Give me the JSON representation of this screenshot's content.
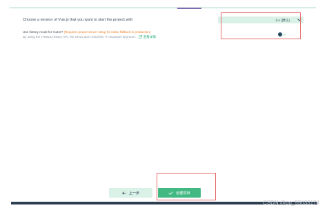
{
  "question": "Choose a version of Vue.js that you want to start the project with",
  "version_select": {
    "value": "3.x (默认)"
  },
  "router": {
    "label": "Use history mode for router?",
    "hint": "(Requires proper server setup for index fallback in production)",
    "description": "By using the HTML5 History API, the URLs don't need the '#' character anymore.",
    "more_link": "查看详情",
    "enabled": false
  },
  "buttons": {
    "previous": "上一步",
    "create": "创建项目"
  },
  "watermark": "CSDN @qq_55033174",
  "colors": {
    "accent": "#42b883",
    "accent_light": "#d9f1e6",
    "hint_orange": "#ee7b1f",
    "highlight_red": "#e9696a",
    "dark": "#2c3e50"
  },
  "icons": [
    "chevron-down-icon",
    "external-link-icon",
    "arrow-left-icon",
    "check-icon"
  ]
}
